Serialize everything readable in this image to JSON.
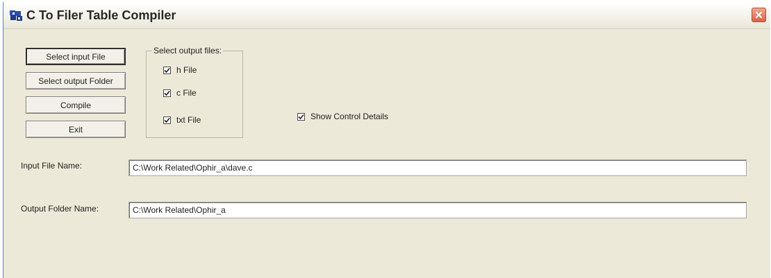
{
  "window": {
    "title": "C To Filer Table Compiler",
    "close_symbol": "✕"
  },
  "buttons": {
    "select_input": "Select input File",
    "select_output_folder": "Select output Folder",
    "compile": "Compile",
    "exit": "Exit"
  },
  "output_files": {
    "group_label": "Select output files:",
    "h_file": {
      "label": "h File",
      "checked": true
    },
    "c_file": {
      "label": "c File",
      "checked": true
    },
    "txt_file": {
      "label": "txt File",
      "checked": true
    }
  },
  "show_details": {
    "label": "Show Control Details",
    "checked": true
  },
  "input_file": {
    "label": "Input File Name:",
    "value": "C:\\Work Related\\Ophir_a\\dave.c"
  },
  "output_folder": {
    "label": "Output Folder Name:",
    "value": "C:\\Work Related\\Ophir_a"
  },
  "colors": {
    "title_text": "#2a2a2a",
    "window_bg": "#ece9d8",
    "close_button": "#d9644a"
  },
  "icons": {
    "app": "app-icon",
    "close": "close-icon",
    "checkmark": "checkmark-icon"
  }
}
